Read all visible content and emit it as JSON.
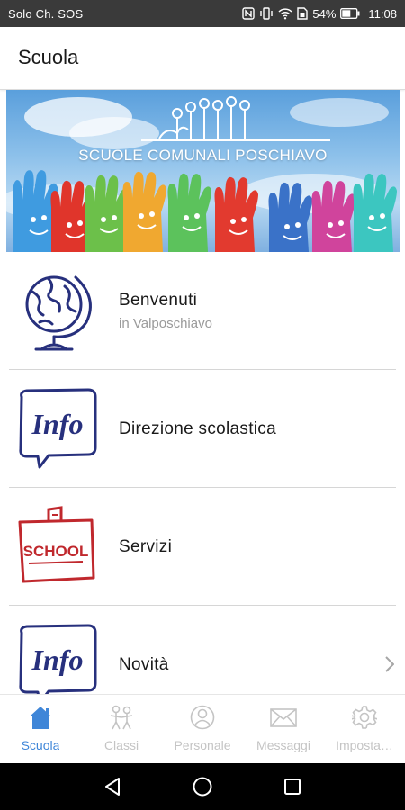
{
  "status_bar": {
    "carrier": "Solo Ch. SOS",
    "battery": "54%",
    "time": "11:08"
  },
  "app_bar": {
    "title": "Scuola"
  },
  "banner": {
    "text": "SCUOLE COMUNALI POSCHIAVO"
  },
  "list": {
    "items": [
      {
        "label": "Benvenuti",
        "sublabel": "in Valposchiavo",
        "icon": "globe-icon"
      },
      {
        "label": "Direzione scolastica",
        "icon": "info-bubble-icon"
      },
      {
        "label": "Servizi",
        "icon": "school-note-icon",
        "icon_text": "SCHOOL"
      },
      {
        "label": "Novità",
        "icon": "info-bubble-icon"
      }
    ],
    "info_text": "Info"
  },
  "bottom_nav": {
    "items": [
      {
        "label": "Scuola",
        "icon": "home-icon",
        "active": true
      },
      {
        "label": "Classi",
        "icon": "children-icon",
        "active": false
      },
      {
        "label": "Personale",
        "icon": "person-icon",
        "active": false
      },
      {
        "label": "Messaggi",
        "icon": "mail-icon",
        "active": false
      },
      {
        "label": "Imposta…",
        "icon": "gear-icon",
        "active": false
      }
    ]
  },
  "colors": {
    "accent": "#3f86d8",
    "icon_navy": "#27307d",
    "icon_red": "#c0282d",
    "inactive": "#c4c4c4"
  }
}
